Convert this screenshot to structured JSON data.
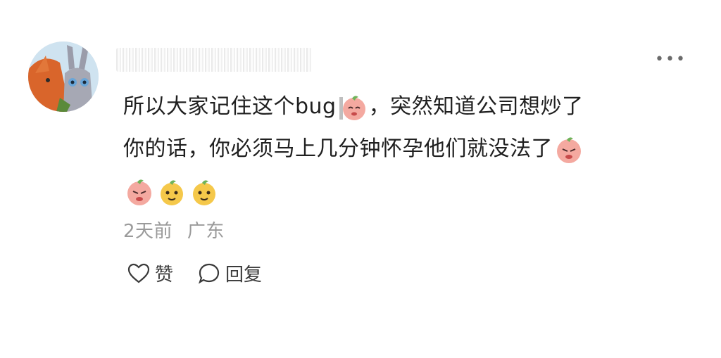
{
  "comment": {
    "line1_a": "所以大家记住这个bug",
    "line1_b": "，突然知道公司想炒了",
    "line2": "你的话，你必须马上几分钟怀孕他们就没法了",
    "time": "2天前",
    "location": "广东"
  },
  "actions": {
    "like_label": "赞",
    "reply_label": "回复"
  },
  "icons": {
    "more": "more-icon",
    "like": "heart-outline-icon",
    "reply": "speech-bubble-icon"
  },
  "colors": {
    "text": "#202020",
    "meta": "#9a9a9a",
    "icon": "#3a3a3a"
  }
}
